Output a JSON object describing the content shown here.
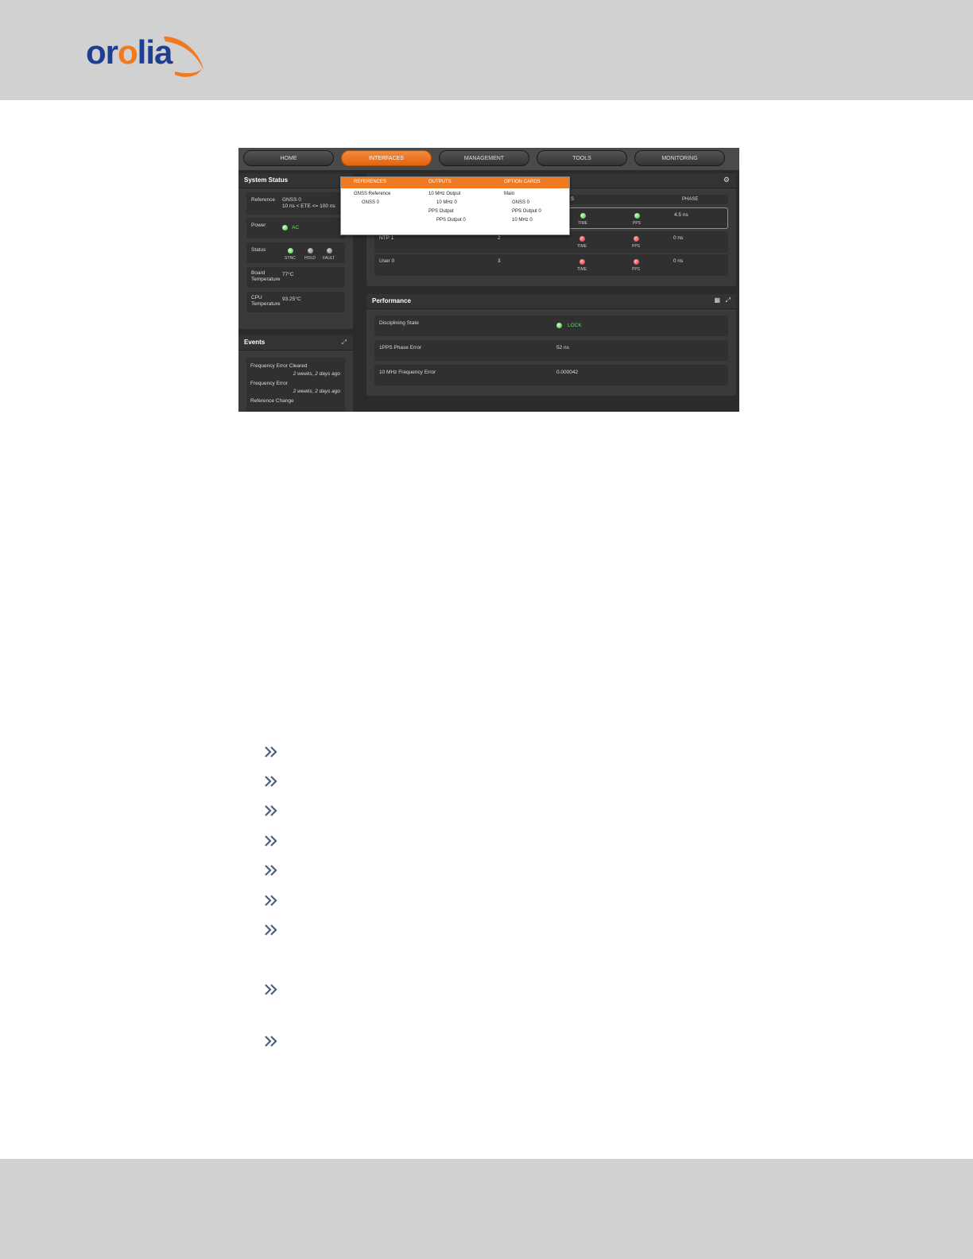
{
  "brand": {
    "logo_text_a": "or",
    "logo_text_b": "o",
    "logo_text_c": "lia"
  },
  "ui": {
    "nav": [
      "HOME",
      "INTERFACES",
      "MANAGEMENT",
      "TOOLS",
      "MONITORING"
    ],
    "system_status": {
      "title": "System Status",
      "reference_label": "Reference",
      "reference_value": "GNSS 0",
      "reference_detail": "10 ns < ETE <= 100 ns",
      "power_label": "Power",
      "power_value": "AC",
      "status_label": "Status",
      "status_sync": "SYNC",
      "status_hold": "HOLD",
      "status_fault": "FAULT",
      "board_temp_label": "Board Temperature",
      "board_temp_value": "77°C",
      "cpu_temp_label": "CPU Temperature",
      "cpu_temp_value": "93.25°C"
    },
    "events": {
      "title": "Events",
      "items": [
        {
          "name": "Frequency Error Cleared",
          "when": "2 weeks, 2 days ago"
        },
        {
          "name": "Frequency Error",
          "when": "2 weeks, 2 days ago"
        },
        {
          "name": "Reference Change",
          "when": ""
        }
      ]
    },
    "references": {
      "col_s": "S",
      "col_phase": "PHASE",
      "rows": [
        {
          "name": "NTP 1",
          "priority": "2",
          "time": "TIME",
          "pps": "PPS",
          "phase": "0 ns"
        },
        {
          "name": "User 0",
          "priority": "3",
          "time": "TIME",
          "pps": "PPS",
          "phase": "0 ns"
        }
      ],
      "top_row": {
        "time": "TIME",
        "pps": "PPS",
        "phase": "4.5 ns"
      }
    },
    "performance": {
      "title": "Performance",
      "disciplining_label": "Disciplining State",
      "disciplining_value": "LOCK",
      "phase_error_label": "1PPS Phase Error",
      "phase_error_value": "52 ns",
      "freq_error_label": "10 MHz Frequency Error",
      "freq_error_value": "0.000042"
    },
    "dropdown": {
      "col1_header": "REFERENCES",
      "col2_header": "OUTPUTS",
      "col3_header": "OPTION CARDS",
      "col1_items": [
        "GNSS Reference",
        "GNSS 0"
      ],
      "col2_items": [
        "10 MHz Output",
        "10 MHz 0",
        "PPS Output",
        "PPS Output 0"
      ],
      "col3_items": [
        "Main",
        "GNSS 0",
        "PPS Output 0",
        "10 MHz 0"
      ]
    }
  },
  "colors": {
    "accent": "#f07a22",
    "brand_blue": "#1e3f8f",
    "band_gray": "#d1d1d1",
    "bullet": "#4a5f7f"
  },
  "bullet_icon": "double-chevron-right-icon"
}
